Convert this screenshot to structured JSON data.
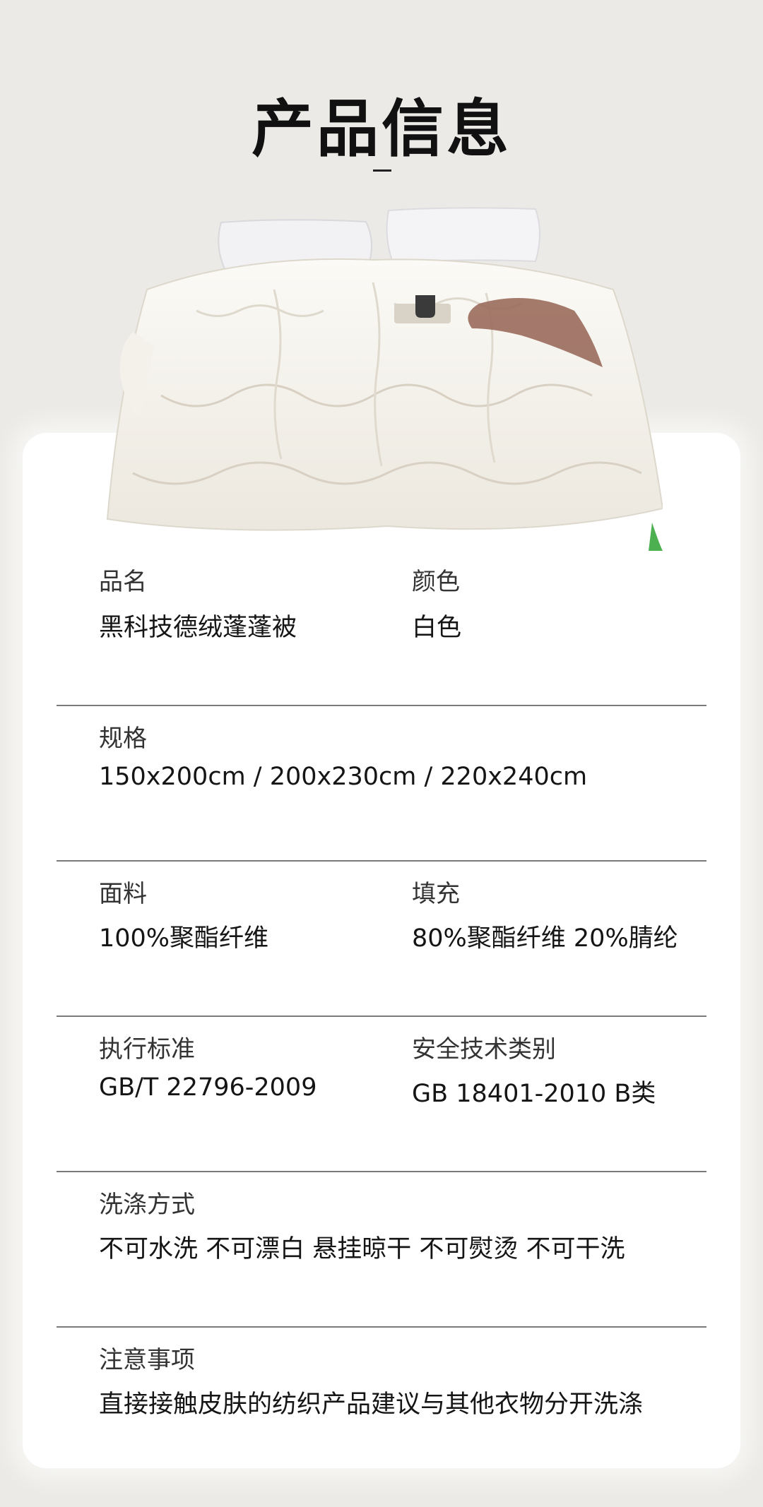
{
  "header": {
    "title": "产品信息"
  },
  "specs": [
    [
      {
        "label": "品名",
        "value": "黑科技德绒蓬蓬被"
      },
      {
        "label": "颜色",
        "value": "白色"
      }
    ],
    [
      {
        "label": "规格",
        "value": "150x200cm / 200x230cm / 220x240cm"
      }
    ],
    [
      {
        "label": "面料",
        "value": "100%聚酯纤维"
      },
      {
        "label": "填充",
        "value": "80%聚酯纤维  20%腈纶"
      }
    ],
    [
      {
        "label": "执行标准",
        "value": "GB/T 22796-2009"
      },
      {
        "label": "安全技术类别",
        "value": "GB 18401-2010 B类"
      }
    ],
    [
      {
        "label": "洗涤方式",
        "value": "不可水洗  不可漂白  悬挂晾干  不可熨烫  不可干洗"
      }
    ],
    [
      {
        "label": "注意事项",
        "value": "直接接触皮肤的纺织产品建议与其他衣物分开洗涤"
      }
    ]
  ],
  "colors": {
    "background": "#ebeae6",
    "card": "#ffffff",
    "divider": "#7a7a7a",
    "throw": "#9a6b5c"
  }
}
